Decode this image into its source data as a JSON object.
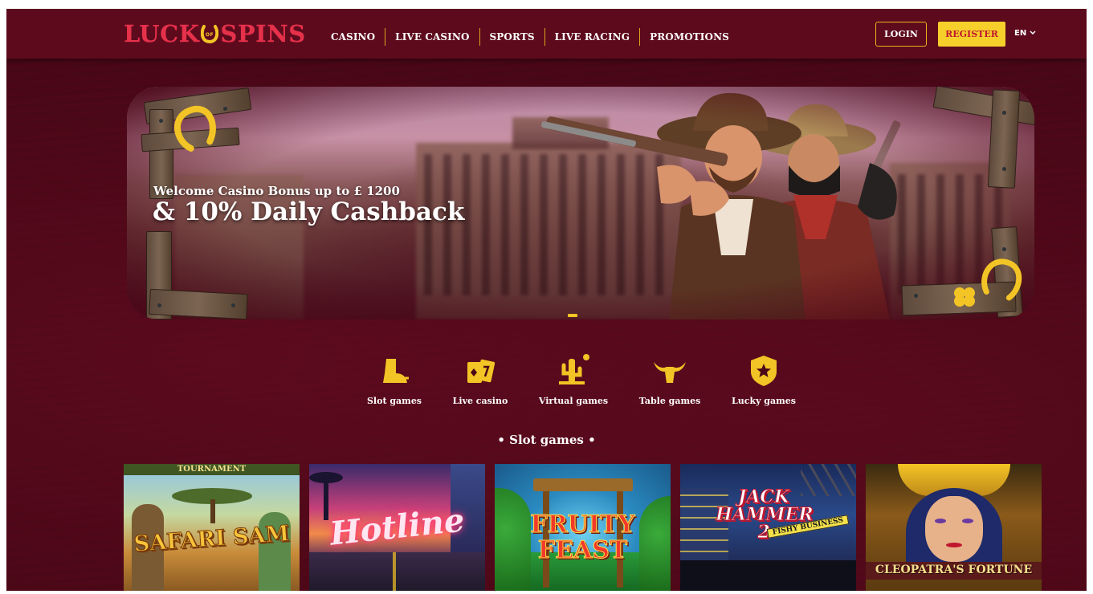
{
  "brand": {
    "logo_left": "LUCK",
    "logo_mid": "OF",
    "logo_right": "SPINS",
    "accent_red": "#e6314b",
    "accent_gold": "#f6cf2a",
    "background": "#4a0717"
  },
  "nav": {
    "items": [
      {
        "label": "CASINO"
      },
      {
        "label": "LIVE CASINO"
      },
      {
        "label": "SPORTS"
      },
      {
        "label": "LIVE RACING"
      },
      {
        "label": "PROMOTIONS"
      }
    ]
  },
  "header": {
    "login_label": "LOGIN",
    "register_label": "REGISTER",
    "language": "EN"
  },
  "hero": {
    "subtitle": "Welcome Casino Bonus up to £ 1200",
    "title": "& 10% Daily Cashback"
  },
  "categories": [
    {
      "label": "Slot games",
      "icon": "boot-icon"
    },
    {
      "label": "Live casino",
      "icon": "cards-icon"
    },
    {
      "label": "Virtual games",
      "icon": "cactus-icon"
    },
    {
      "label": "Table games",
      "icon": "bull-skull-icon"
    },
    {
      "label": "Lucky games",
      "icon": "sheriff-badge-icon"
    }
  ],
  "section": {
    "title": "• Slot games •"
  },
  "games": [
    {
      "name": "SAFARI SAM",
      "badge": "TOURNAMENT"
    },
    {
      "name": "Hotline"
    },
    {
      "name": "FRUITY FEAST"
    },
    {
      "name": "JACK HAMMER 2",
      "tagline": "FISHY BUSINESS"
    },
    {
      "name": "CLEOPATRA'S FORTUNE"
    }
  ]
}
